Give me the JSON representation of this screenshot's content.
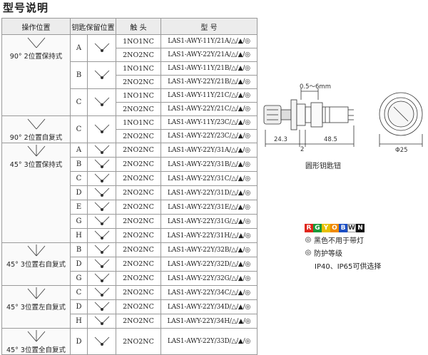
{
  "title": "型号说明",
  "table": {
    "headers": {
      "operation": "操作位置",
      "key_hold": "钥匙保留位置",
      "contact": "触 头",
      "model": "型 号"
    },
    "groups": [
      {
        "label": "90° 2位置保持式",
        "diagram": "L-R",
        "rows": [
          {
            "pos": "A",
            "contact": "1NO1NC",
            "model": "LAS1-AWY-11Y/21A/△/▲/◎"
          },
          {
            "pos": "",
            "contact": "2NO2NC",
            "model": "LAS1-AWY-22Y/21A/△/▲/◎"
          },
          {
            "pos": "B",
            "contact": "1NO1NC",
            "model": "LAS1-AWY-11Y/21B/△/▲/◎"
          },
          {
            "pos": "",
            "contact": "2NO2NC",
            "model": "LAS1-AWY-22Y/21B/△/▲/◎"
          },
          {
            "pos": "C",
            "contact": "1NO1NC",
            "model": "LAS1-AWY-11Y/21C/△/▲/◎"
          },
          {
            "pos": "",
            "contact": "2NO2NC",
            "model": "LAS1-AWY-22Y/21C/△/▲/◎"
          }
        ]
      },
      {
        "label": "90° 2位置自复式",
        "diagram": "L-R",
        "rows": [
          {
            "pos": "C",
            "contact": "1NO1NC",
            "model": "LAS1-AWY-11Y/23C/△/▲/◎"
          },
          {
            "pos": "",
            "contact": "2NO2NC",
            "model": "LAS1-AWY-22Y/23C/△/▲/◎"
          }
        ]
      },
      {
        "label": "45° 3位置保持式",
        "diagram": "L-C-R",
        "rows": [
          {
            "pos": "A",
            "contact": "2NO2NC",
            "model": "LAS1-AWY-22Y/31A/△/▲/◎"
          },
          {
            "pos": "B",
            "contact": "2NO2NC",
            "model": "LAS1-AWY-22Y/31B/△/▲/◎"
          },
          {
            "pos": "C",
            "contact": "2NO2NC",
            "model": "LAS1-AWY-22Y/31C/△/▲/◎"
          },
          {
            "pos": "D",
            "contact": "2NO2NC",
            "model": "LAS1-AWY-22Y/31D/△/▲/◎"
          },
          {
            "pos": "E",
            "contact": "2NO2NC",
            "model": "LAS1-AWY-22Y/31E/△/▲/◎"
          },
          {
            "pos": "G",
            "contact": "2NO2NC",
            "model": "LAS1-AWY-22Y/31G/△/▲/◎"
          },
          {
            "pos": "H",
            "contact": "2NO2NC",
            "model": "LAS1-AWY-22Y/31H/△/▲/◎"
          }
        ]
      },
      {
        "label": "45° 3位置右自复式",
        "diagram": "L-C-R",
        "rows": [
          {
            "pos": "B",
            "contact": "2NO2NC",
            "model": "LAS1-AWY-22Y/32B/△/▲/◎"
          },
          {
            "pos": "D",
            "contact": "2NO2NC",
            "model": "LAS1-AWY-22Y/32D/△/▲/◎"
          },
          {
            "pos": "G",
            "contact": "2NO2NC",
            "model": "LAS1-AWY-22Y/32G/△/▲/◎"
          }
        ]
      },
      {
        "label": "45° 3位置左自复式",
        "diagram": "L-C-R",
        "rows": [
          {
            "pos": "C",
            "contact": "2NO2NC",
            "model": "LAS1-AWY-22Y/34C/△/▲/◎"
          },
          {
            "pos": "D",
            "contact": "2NO2NC",
            "model": "LAS1-AWY-22Y/34D/△/▲/◎"
          },
          {
            "pos": "H",
            "contact": "2NO2NC",
            "model": "LAS1-AWY-22Y/34H/△/▲/◎"
          }
        ]
      },
      {
        "label": "45° 3位置全自复式",
        "diagram": "L-C-R",
        "rows": [
          {
            "pos": "D",
            "contact": "2NO2NC",
            "model": "LAS1-AWY-22Y/33D/△/▲/◎"
          }
        ]
      }
    ]
  },
  "drawing": {
    "dim_top": "0.5～6mm",
    "dim_left": "24.3",
    "dim_mid": "2",
    "dim_right": "48.5",
    "dim_dia": "Φ25",
    "caption": "圆形钥匙钮"
  },
  "legend": {
    "color_codes": [
      {
        "letter": "R",
        "color": "#e0261b"
      },
      {
        "letter": "G",
        "color": "#1a9a3a"
      },
      {
        "letter": "Y",
        "color": "#e8c000"
      },
      {
        "letter": "O",
        "color": "#f08a00"
      },
      {
        "letter": "B",
        "color": "#1c4fc4"
      },
      {
        "letter": "W",
        "color": "#ffffff"
      },
      {
        "letter": "N",
        "color": "#111111"
      }
    ],
    "note1_symbol": "◎",
    "note1": "黑色不用于带灯",
    "note2_symbol": "◎",
    "note2": "防护等级",
    "note3": "IP40、IP65可供选择"
  }
}
